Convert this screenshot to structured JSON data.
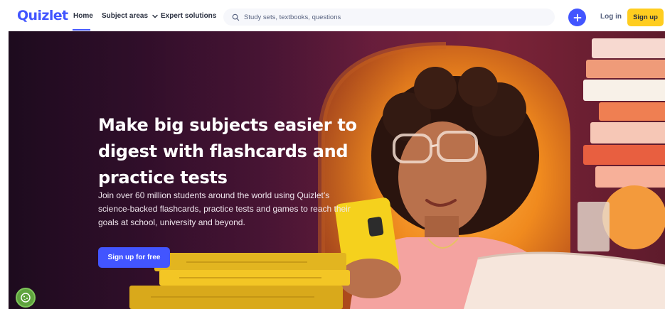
{
  "brand": {
    "logo": "Quizlet",
    "accent": "#4255ff",
    "cta_yellow": "#ffcd1f"
  },
  "nav": {
    "home": "Home",
    "subjects": "Subject areas",
    "expert": "Expert solutions",
    "login": "Log in",
    "signup": "Sign up"
  },
  "search": {
    "placeholder": "Study sets, textbooks, questions",
    "icon": "search-icon"
  },
  "hero": {
    "title": "Make big subjects easier to digest with flashcards and practice tests",
    "subtitle": "Join over 60 million students around the world using Quizlet’s science-backed flashcards, practice tests and games to reach their goals at school, university and beyond.",
    "cta": "Sign up for free"
  },
  "icons": {
    "create": "plus-icon",
    "subjects_caret": "chevron-down-icon",
    "cookie": "cookie-settings-icon"
  }
}
